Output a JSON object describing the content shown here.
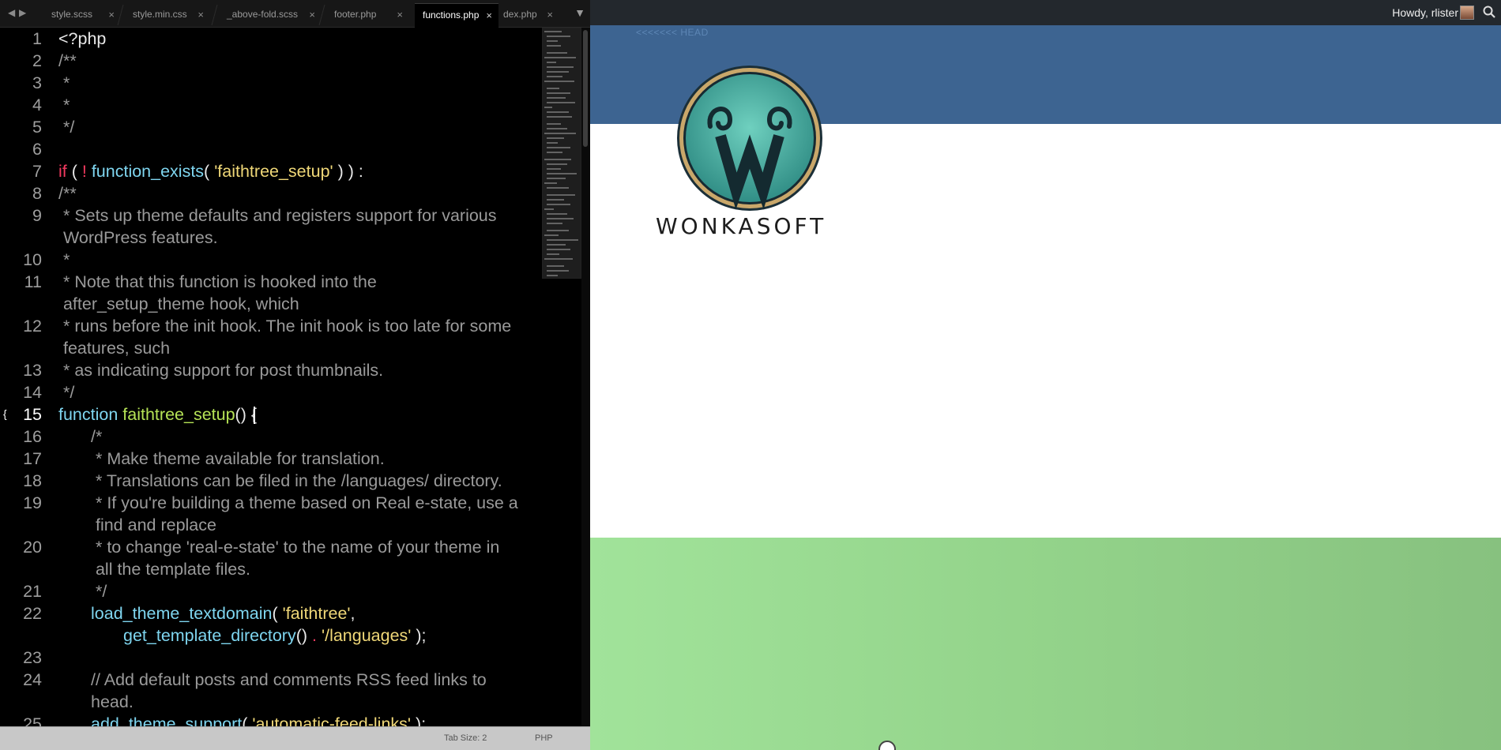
{
  "editor": {
    "tabs": [
      {
        "label": "style.scss",
        "active": false
      },
      {
        "label": "style.min.css",
        "active": false
      },
      {
        "label": "_above-fold.scss",
        "active": false
      },
      {
        "label": "footer.php",
        "active": false
      },
      {
        "label": "functions.php",
        "active": true
      },
      {
        "label": "dex.php",
        "active": false
      }
    ],
    "tab_close_glyph": "×",
    "current_line": 15,
    "lines": [
      {
        "n": "1",
        "segments": [
          {
            "t": "<?php",
            "c": "plain"
          }
        ]
      },
      {
        "n": "2",
        "segments": [
          {
            "t": "/**",
            "c": "comment"
          }
        ]
      },
      {
        "n": "3",
        "segments": [
          {
            "t": " *",
            "c": "comment"
          }
        ]
      },
      {
        "n": "4",
        "segments": [
          {
            "t": " *",
            "c": "comment"
          }
        ]
      },
      {
        "n": "5",
        "segments": [
          {
            "t": " */",
            "c": "comment"
          }
        ]
      },
      {
        "n": "6",
        "segments": []
      },
      {
        "n": "7",
        "segments": [
          {
            "t": "if",
            "c": "kw"
          },
          {
            "t": " ( ",
            "c": "plain"
          },
          {
            "t": "!",
            "c": "op"
          },
          {
            "t": " ",
            "c": "plain"
          },
          {
            "t": "function_exists",
            "c": "fn"
          },
          {
            "t": "( ",
            "c": "plain"
          },
          {
            "t": "'faithtree_setup'",
            "c": "str"
          },
          {
            "t": " ) ) :",
            "c": "plain"
          }
        ]
      },
      {
        "n": "8",
        "segments": [
          {
            "t": "/**",
            "c": "comment"
          }
        ]
      },
      {
        "n": "9",
        "segments": [
          {
            "t": " * Sets up theme defaults and registers support for various",
            "c": "comment"
          }
        ]
      },
      {
        "n": "",
        "segments": [
          {
            "t": " WordPress features.",
            "c": "comment"
          }
        ]
      },
      {
        "n": "10",
        "segments": [
          {
            "t": " *",
            "c": "comment"
          }
        ]
      },
      {
        "n": "11",
        "segments": [
          {
            "t": " * Note that this function is hooked into the",
            "c": "comment"
          }
        ]
      },
      {
        "n": "",
        "segments": [
          {
            "t": " after_setup_theme hook, which",
            "c": "comment"
          }
        ]
      },
      {
        "n": "12",
        "segments": [
          {
            "t": " * runs before the init hook. The init hook is too late for some",
            "c": "comment"
          }
        ]
      },
      {
        "n": "",
        "segments": [
          {
            "t": " features, such",
            "c": "comment"
          }
        ]
      },
      {
        "n": "13",
        "segments": [
          {
            "t": " * as indicating support for post thumbnails.",
            "c": "comment"
          }
        ]
      },
      {
        "n": "14",
        "segments": [
          {
            "t": " */",
            "c": "comment"
          }
        ]
      },
      {
        "n": "15",
        "segments": [
          {
            "t": "function",
            "c": "fn"
          },
          {
            "t": " ",
            "c": "plain"
          },
          {
            "t": "faithtree_setup",
            "c": "fndef"
          },
          {
            "t": "() {",
            "c": "plain"
          }
        ]
      },
      {
        "n": "16",
        "indent": 1,
        "segments": [
          {
            "t": "/*",
            "c": "comment"
          }
        ]
      },
      {
        "n": "17",
        "indent": 1,
        "segments": [
          {
            "t": " * Make theme available for translation.",
            "c": "comment"
          }
        ]
      },
      {
        "n": "18",
        "indent": 1,
        "segments": [
          {
            "t": " * Translations can be filed in the /languages/ directory.",
            "c": "comment"
          }
        ]
      },
      {
        "n": "19",
        "indent": 1,
        "segments": [
          {
            "t": " * If you're building a theme based on Real e-state, use a",
            "c": "comment"
          }
        ]
      },
      {
        "n": "",
        "indent": 1,
        "segments": [
          {
            "t": " find and replace",
            "c": "comment"
          }
        ]
      },
      {
        "n": "20",
        "indent": 1,
        "segments": [
          {
            "t": " * to change 'real-e-state' to the name of your theme in",
            "c": "comment"
          }
        ]
      },
      {
        "n": "",
        "indent": 1,
        "segments": [
          {
            "t": " all the template files.",
            "c": "comment"
          }
        ]
      },
      {
        "n": "21",
        "indent": 1,
        "segments": [
          {
            "t": " */",
            "c": "comment"
          }
        ]
      },
      {
        "n": "22",
        "indent": 1,
        "segments": [
          {
            "t": "load_theme_textdomain",
            "c": "fn"
          },
          {
            "t": "( ",
            "c": "plain"
          },
          {
            "t": "'faithtree'",
            "c": "str"
          },
          {
            "t": ",",
            "c": "plain"
          }
        ]
      },
      {
        "n": "",
        "indent": 2,
        "segments": [
          {
            "t": "get_template_directory",
            "c": "fn"
          },
          {
            "t": "() ",
            "c": "plain"
          },
          {
            "t": ".",
            "c": "op"
          },
          {
            "t": " ",
            "c": "plain"
          },
          {
            "t": "'/languages'",
            "c": "str"
          },
          {
            "t": " );",
            "c": "plain"
          }
        ]
      },
      {
        "n": "23",
        "segments": []
      },
      {
        "n": "24",
        "indent": 1,
        "segments": [
          {
            "t": "// Add default posts and comments RSS feed links to",
            "c": "comment"
          }
        ]
      },
      {
        "n": "",
        "indent": 1,
        "segments": [
          {
            "t": "head.",
            "c": "comment"
          }
        ]
      },
      {
        "n": "25",
        "indent": 1,
        "segments": [
          {
            "t": "add_theme_support",
            "c": "fn"
          },
          {
            "t": "( ",
            "c": "plain"
          },
          {
            "t": "'automatic-feed-links'",
            "c": "str"
          },
          {
            "t": " );",
            "c": "plain"
          }
        ]
      }
    ],
    "status": {
      "tab_size": "Tab Size: 2",
      "syntax": "PHP"
    }
  },
  "preview": {
    "admin_greeting": "Howdy, rlister",
    "merge_marker": "<<<<<<< HEAD",
    "logo_text": "WONKASOFT",
    "colors": {
      "admin_bar": "#23282d",
      "header_band": "#3d6491",
      "footer_green": "#93d38a",
      "logo_teal": "#4fb9a8",
      "logo_gold": "#c9a76a"
    }
  }
}
